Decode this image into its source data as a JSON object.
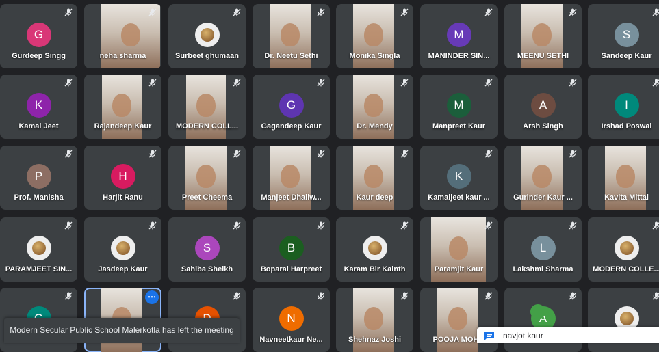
{
  "participants": [
    {
      "name": "Gurdeep Singg",
      "initial": "G",
      "color": "#d93777",
      "muted": true,
      "video": false
    },
    {
      "name": "neha sharma",
      "muted": true,
      "video": true
    },
    {
      "name": "Surbeet ghumaan",
      "muted": true,
      "video": false,
      "photo": true
    },
    {
      "name": "Dr. Neetu Sethi",
      "muted": true,
      "video": true
    },
    {
      "name": "Monika Singla",
      "muted": true,
      "video": true
    },
    {
      "name": "MANINDER SIN...",
      "initial": "M",
      "color": "#673ab7",
      "muted": true,
      "video": false
    },
    {
      "name": "MEENU SETHI",
      "muted": true,
      "video": true
    },
    {
      "name": "Sandeep Kaur",
      "initial": "S",
      "color": "#78909c",
      "muted": true,
      "video": false
    },
    {
      "name": "Kamal Jeet",
      "initial": "K",
      "color": "#8e24aa",
      "muted": true,
      "video": false
    },
    {
      "name": "Rajandeep Kaur",
      "muted": true,
      "video": true
    },
    {
      "name": "MODERN COLL...",
      "muted": true,
      "video": true
    },
    {
      "name": "Gagandeep Kaur",
      "initial": "G",
      "color": "#5e35b1",
      "muted": true,
      "video": false
    },
    {
      "name": "Dr. Mendy",
      "muted": true,
      "video": true
    },
    {
      "name": "Manpreet Kaur",
      "initial": "M",
      "color": "#1b5e3b",
      "muted": true,
      "video": false
    },
    {
      "name": "Arsh Singh",
      "initial": "A",
      "color": "#6d4c41",
      "muted": true,
      "video": false
    },
    {
      "name": "Irshad Poswal",
      "initial": "I",
      "color": "#00897b",
      "muted": true,
      "video": false
    },
    {
      "name": "Prof. Manisha",
      "initial": "P",
      "color": "#8d6e63",
      "muted": true,
      "video": false
    },
    {
      "name": "Harjit Ranu",
      "initial": "H",
      "color": "#d81b60",
      "muted": true,
      "video": false
    },
    {
      "name": "Preet Cheema",
      "muted": true,
      "video": true
    },
    {
      "name": "Manjeet Dhaliw...",
      "muted": true,
      "video": true
    },
    {
      "name": "Kaur deep",
      "muted": true,
      "video": true
    },
    {
      "name": "Kamaljeet kaur ...",
      "initial": "K",
      "color": "#546e7a",
      "muted": true,
      "video": false
    },
    {
      "name": "Gurinder Kaur ...",
      "muted": true,
      "video": true
    },
    {
      "name": "Kavita Mittal",
      "muted": false,
      "video": true
    },
    {
      "name": "PARAMJEET SIN...",
      "muted": true,
      "video": false,
      "photo": true
    },
    {
      "name": "Jasdeep Kaur",
      "muted": true,
      "video": false,
      "photo": true
    },
    {
      "name": "Sahiba Sheikh",
      "initial": "S",
      "color": "#ab47bc",
      "muted": true,
      "video": false
    },
    {
      "name": "Boparai Harpreet",
      "initial": "B",
      "color": "#1b5e20",
      "muted": true,
      "video": false
    },
    {
      "name": "Karam Bir Kainth",
      "muted": true,
      "video": false,
      "photo": true
    },
    {
      "name": "Paramjit Kaur",
      "muted": true,
      "video": true
    },
    {
      "name": "Lakshmi Sharma",
      "initial": "L",
      "color": "#78909c",
      "muted": true,
      "video": false
    },
    {
      "name": "MODERN COLLE...",
      "muted": true,
      "video": false,
      "photo": true
    },
    {
      "name": "",
      "initial": "G",
      "color": "#00897b",
      "muted": true,
      "video": false
    },
    {
      "name": "",
      "muted": false,
      "video": true,
      "active": true
    },
    {
      "name": "",
      "initial": "D",
      "color": "#e65100",
      "muted": true,
      "video": false
    },
    {
      "name": "Navneetkaur Ne...",
      "initial": "N",
      "color": "#ef6c00",
      "muted": true,
      "video": false
    },
    {
      "name": "Shehnaz Joshi",
      "muted": true,
      "video": true
    },
    {
      "name": "POOJA MOH...",
      "muted": true,
      "video": true
    },
    {
      "name": "",
      "initial": "A",
      "color": "#43a047",
      "muted": true,
      "video": false
    },
    {
      "name": "",
      "muted": true,
      "video": false,
      "photo": true
    }
  ],
  "notification": {
    "text": "Modern Secular Public School Malerkotla has left the meeting"
  },
  "chat_popup": {
    "sender": "navjot kaur"
  }
}
